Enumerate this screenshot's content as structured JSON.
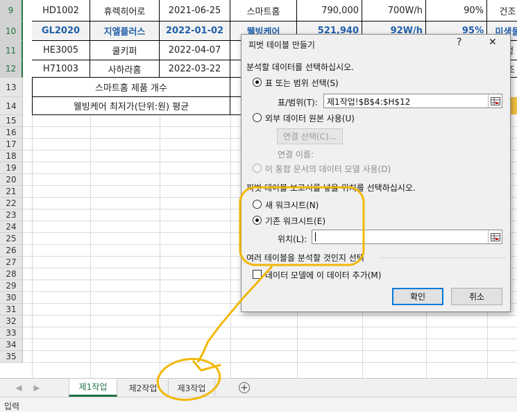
{
  "sheet": {
    "rows": [
      {
        "num": "9",
        "cells": [
          "HD1002",
          "휴렉히어로",
          "2021-06-25",
          "스마트홈",
          "790,000",
          "700W/h",
          "90%",
          "건조"
        ],
        "blue": false
      },
      {
        "num": "10",
        "cells": [
          "GL2020",
          "지엘플러스",
          "2022-01-02",
          "웰빙케어",
          "521,940",
          "92W/h",
          "95%",
          "미생물"
        ],
        "blue": true
      },
      {
        "num": "11",
        "cells": [
          "HE3005",
          "쿨키퍼",
          "2022-04-07",
          "",
          "",
          "",
          "",
          "생"
        ],
        "blue": false
      },
      {
        "num": "12",
        "cells": [
          "H71003",
          "사하라홈",
          "2022-03-22",
          "",
          "",
          "",
          "",
          "조"
        ],
        "blue": false
      }
    ],
    "summary": [
      "스마트홈 제품 개수",
      "웰빙케어 최저가(단위:원) 평균"
    ],
    "empty_rows": [
      "15",
      "16",
      "17",
      "18",
      "19",
      "20",
      "21",
      "22",
      "23",
      "24",
      "25",
      "26",
      "27",
      "28",
      "29",
      "30",
      "31",
      "32",
      "33",
      "34",
      "35"
    ],
    "label_rows": [
      "13",
      "14"
    ]
  },
  "dialog": {
    "title": "피벗 테이블 만들기",
    "help": "?",
    "close": "✕",
    "section1": "분석할 데이터를 선택하십시오.",
    "opt_range": "표 또는 범위 선택(S)",
    "range_label": "표/범위(T):",
    "range_value": "제1작업!$B$4:$H$12",
    "opt_external": "외부 데이터 원본 사용(U)",
    "conn_button": "연결 선택(C)...",
    "conn_name": "연결 이름:",
    "opt_model": "이 통합 문서의 데이터 모델 사용(D)",
    "section2": "피벗 테이블 보고서를 넣을 위치를 선택하십시오.",
    "opt_new_sheet": "새 워크시트(N)",
    "opt_existing_sheet": "기존 워크시트(E)",
    "location_label": "위치(L):",
    "location_value": "",
    "section3": "여러 테이블을 분석할 것인지 선택",
    "add_model": "데이터 모델에 이 데이터 추가(M)",
    "ok": "확인",
    "cancel": "취소"
  },
  "tabs": [
    "제1작업",
    "제2작업",
    "제3작업"
  ],
  "add_sheet": "+",
  "status": "입력",
  "colors": {
    "excel_green": "#217346",
    "annotation": "#f2b705",
    "blue_text": "#1f5fa9"
  }
}
